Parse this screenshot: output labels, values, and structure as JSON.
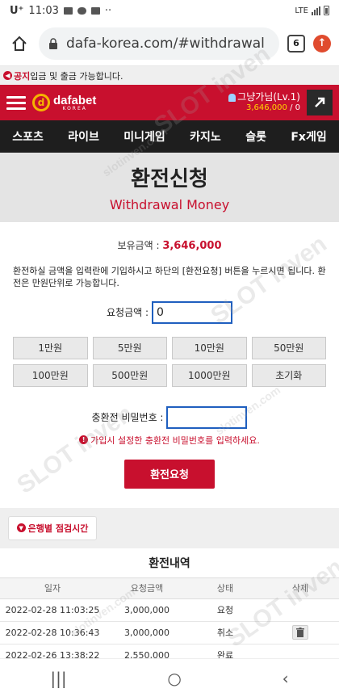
{
  "status_bar": {
    "carrier": "U⁺",
    "time": "11:03",
    "dots": "··",
    "network": "LTE"
  },
  "browser": {
    "url": "dafa-korea.com/#withdrawal",
    "tab_count": "6"
  },
  "notice": {
    "tag": "공지",
    "text": "입금 및 출금 가능합니다."
  },
  "header": {
    "brand": "dafabet",
    "brand_sub": "KOREA",
    "username": "그냥가님(Lv.1)",
    "balance": "3,646,000",
    "balance_extra": "/ 0"
  },
  "nav": [
    "스포츠",
    "라이브",
    "미니게임",
    "카지노",
    "슬롯",
    "Fx게임"
  ],
  "title": {
    "ko": "환전신청",
    "en": "Withdrawal Money"
  },
  "holding": {
    "label": "보유금액 :",
    "amount": "3,646,000"
  },
  "description": "환전하실 금액을 입력란에 기입하시고 하단의 [환전요청] 버튼을 누르시면 됩니다. 환전은 만원단위로 가능합니다.",
  "request": {
    "label": "요청금액 :",
    "value": "0"
  },
  "amount_buttons": [
    "1만원",
    "5만원",
    "10만원",
    "50만원",
    "100만원",
    "500만원",
    "1000만원",
    "초기화"
  ],
  "password": {
    "label": "충환전 비밀번호 :",
    "warning": "가입시 설정한 충환전 비밀번호를 입력하세요."
  },
  "submit_label": "환전요청",
  "bank_button": "은행별 점검시간",
  "history": {
    "title": "환전내역",
    "headers": [
      "일자",
      "요청금액",
      "상태",
      "삭제"
    ],
    "rows": [
      {
        "date": "2022-02-28 11:03:25",
        "amount": "3,000,000",
        "status": "요청"
      },
      {
        "date": "2022-02-28 10:36:43",
        "amount": "3,000,000",
        "status": "취소"
      },
      {
        "date": "2022-02-26 13:38:22",
        "amount": "2,550,000",
        "status": "완료"
      }
    ]
  },
  "watermark": {
    "main": "SLOT inven",
    "sub": "slotinven.com"
  },
  "colors": {
    "brand_red": "#c8102e",
    "nav_dark": "#1e1e1e",
    "input_border": "#1f5fbf",
    "accent_gold": "#ffd400"
  }
}
